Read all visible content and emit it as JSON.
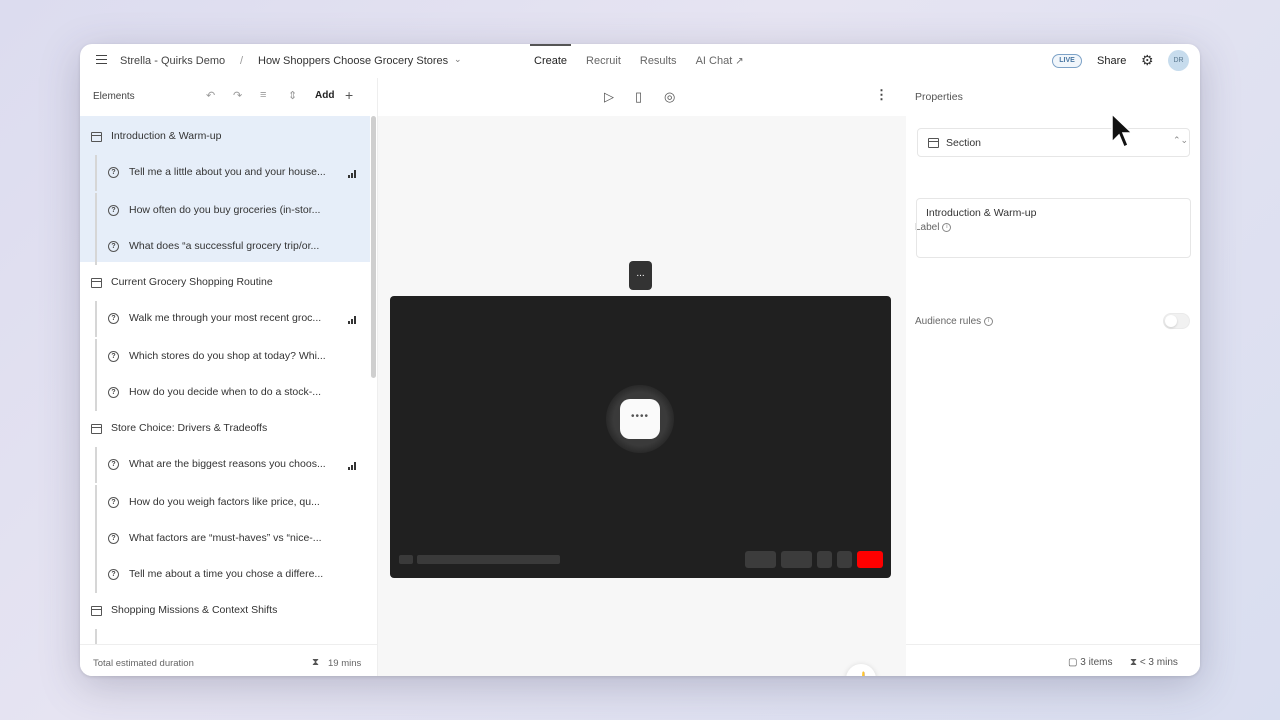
{
  "topbar": {
    "org": "Strella - Quirks Demo",
    "separator": "/",
    "study_title": "How Shoppers Choose Grocery Stores",
    "tabs": [
      {
        "label": "Create",
        "active": true
      },
      {
        "label": "Recruit",
        "active": false
      },
      {
        "label": "Results",
        "active": false
      },
      {
        "label": "AI Chat",
        "active": false
      }
    ],
    "live_badge": "LIVE",
    "share_label": "Share",
    "avatar_initials": "DR"
  },
  "elements_panel": {
    "title": "Elements",
    "add_label": "Add",
    "sections": [
      {
        "label": "Introduction & Warm-up",
        "selected": true,
        "questions": [
          {
            "label": "Tell me a little about you and your house...",
            "has_bars": true
          },
          {
            "label": "How often do you buy groceries (in-stor...",
            "has_bars": false
          },
          {
            "label": "What does “a successful grocery trip/or...",
            "has_bars": false
          }
        ]
      },
      {
        "label": "Current Grocery Shopping Routine",
        "selected": false,
        "questions": [
          {
            "label": "Walk me through your most recent groc...",
            "has_bars": true
          },
          {
            "label": "Which stores do you shop at today? Whi...",
            "has_bars": false
          },
          {
            "label": "How do you decide when to do a stock-...",
            "has_bars": false
          }
        ]
      },
      {
        "label": "Store Choice: Drivers & Tradeoffs",
        "selected": false,
        "questions": [
          {
            "label": "What are the biggest reasons you choos...",
            "has_bars": true
          },
          {
            "label": "How do you weigh factors like price, qu...",
            "has_bars": false
          },
          {
            "label": "What factors are “must-haves” vs “nice-...",
            "has_bars": false
          },
          {
            "label": "Tell me about a time you chose a differe...",
            "has_bars": false
          }
        ]
      },
      {
        "label": "Shopping Missions & Context Shifts",
        "selected": false,
        "questions": []
      }
    ],
    "footer": {
      "label": "Total estimated duration",
      "value": "19 mins"
    }
  },
  "preview": {
    "bubble_text": "...",
    "loader_text": "••••"
  },
  "properties": {
    "title": "Properties",
    "type_value": "Section",
    "label_field": "Label",
    "label_value": "Introduction & Warm-up",
    "audience_rules": "Audience rules",
    "footer": {
      "items": "3 items",
      "time": "< 3 mins"
    }
  },
  "colors": {
    "selected_row": "#e6eef9",
    "live_badge": "#4a77a3",
    "record_button": "#ff0000",
    "video_bg": "#202020"
  }
}
